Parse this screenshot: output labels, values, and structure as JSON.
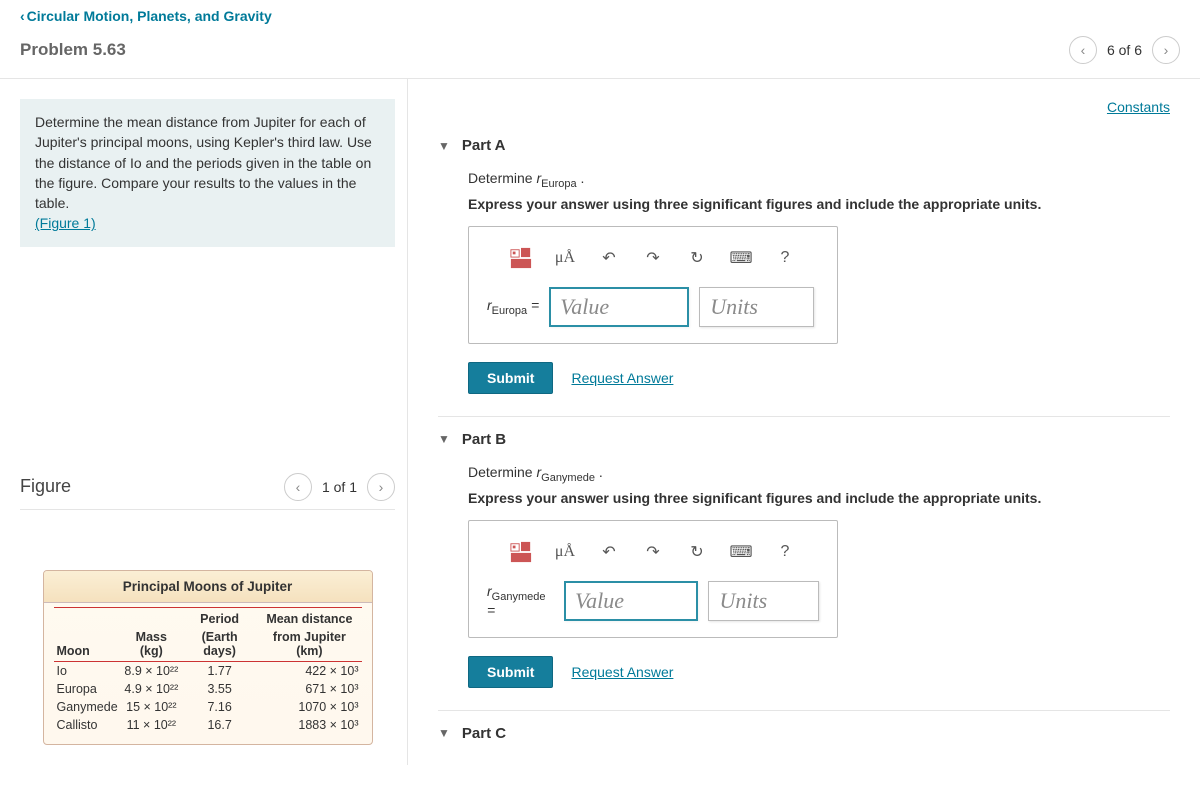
{
  "chapter_link": "Circular Motion, Planets, and Gravity",
  "problem_title": "Problem 5.63",
  "nav": {
    "position": "6 of 6"
  },
  "constants_link": "Constants",
  "prompt_text": "Determine the mean distance from Jupiter for each of Jupiter's principal moons, using Kepler's third law. Use the distance of Io and the periods given in the table on the figure. Compare your results to the values in the table.",
  "figure_link": "(Figure 1)",
  "figure": {
    "title": "Figure",
    "position": "1 of 1",
    "caption": "Principal Moons of Jupiter",
    "headers": {
      "moon": "Moon",
      "mass": "Mass (kg)",
      "period_l1": "Period",
      "period_l2": "(Earth days)",
      "dist_l1": "Mean distance",
      "dist_l2": "from Jupiter (km)"
    },
    "rows": [
      {
        "moon": "Io",
        "mass": "8.9 × 10²²",
        "period": "1.77",
        "dist": "422 × 10³"
      },
      {
        "moon": "Europa",
        "mass": "4.9 × 10²²",
        "period": "3.55",
        "dist": "671 × 10³"
      },
      {
        "moon": "Ganymede",
        "mass": "15  × 10²²",
        "period": "7.16",
        "dist": "1070 × 10³"
      },
      {
        "moon": "Callisto",
        "mass": "11  × 10²²",
        "period": "16.7",
        "dist": "1883 × 10³"
      }
    ]
  },
  "parts": {
    "A": {
      "title": "Part A",
      "determine_prefix": "Determine ",
      "var_letter": "r",
      "var_sub": "Europa",
      "determine_suffix": " .",
      "express": "Express your answer using three significant figures and include the appropriate units.",
      "label_sub": "Europa",
      "eq": " = ",
      "value_ph": "Value",
      "units_ph": "Units",
      "toolbar": {
        "ua": "μÅ",
        "help": "?"
      },
      "submit": "Submit",
      "request": "Request Answer"
    },
    "B": {
      "title": "Part B",
      "determine_prefix": "Determine ",
      "var_letter": "r",
      "var_sub": "Ganymede",
      "determine_suffix": " .",
      "express": "Express your answer using three significant figures and include the appropriate units.",
      "label_sub": "Ganymede",
      "eq": " = ",
      "value_ph": "Value",
      "units_ph": "Units",
      "toolbar": {
        "ua": "μÅ",
        "help": "?"
      },
      "submit": "Submit",
      "request": "Request Answer"
    },
    "C": {
      "title": "Part C"
    }
  }
}
